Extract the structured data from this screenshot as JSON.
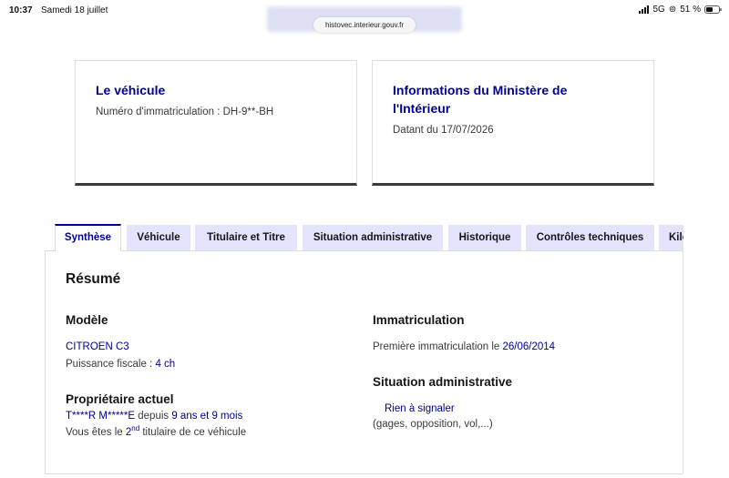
{
  "status_bar": {
    "time": "10:37",
    "date": "Samedi 18 juillet",
    "network": "5G",
    "battery": "51 %"
  },
  "browser": {
    "url": "histovec.interieur.gouv.fr"
  },
  "cards": {
    "vehicle": {
      "title": "Le véhicule",
      "plate_text": "Numéro d'immatriculation : DH-9**-BH"
    },
    "ministry": {
      "title_line1": "Informations du Ministère de",
      "title_line2": "l'Intérieur",
      "date_text": "Datant du 17/07/2026"
    }
  },
  "tabs": [
    {
      "label": "Synthèse",
      "active": true
    },
    {
      "label": "Véhicule",
      "active": false
    },
    {
      "label": "Titulaire et Titre",
      "active": false
    },
    {
      "label": "Situation administrative",
      "active": false
    },
    {
      "label": "Historique",
      "active": false
    },
    {
      "label": "Contrôles techniques",
      "active": false
    },
    {
      "label": "Kilo",
      "active": false
    }
  ],
  "summary": {
    "title": "Résumé",
    "model": {
      "heading": "Modèle",
      "value": "CITROEN C3",
      "power_label": "Puissance fiscale : ",
      "power_value": "4 ch"
    },
    "owner": {
      "heading": "Propriétaire actuel",
      "name": "T****R M*****E",
      "since_label": " depuis ",
      "since_value": "9 ans et 9 mois",
      "rank_prefix": "Vous êtes le ",
      "rank_num": "2",
      "rank_sup": "nd",
      "rank_suffix": " titulaire de ce véhicule"
    },
    "registration": {
      "heading": "Immatriculation",
      "label": "Première immatriculation le ",
      "date": "26/06/2014"
    },
    "admin": {
      "heading": "Situation administrative",
      "status": "Rien à signaler",
      "detail": "(gages, opposition, vol,...)"
    }
  },
  "colors": {
    "accent": "#000091",
    "tab_bg": "#e3e3fd",
    "card_border_bottom": "#3a3a3a"
  }
}
